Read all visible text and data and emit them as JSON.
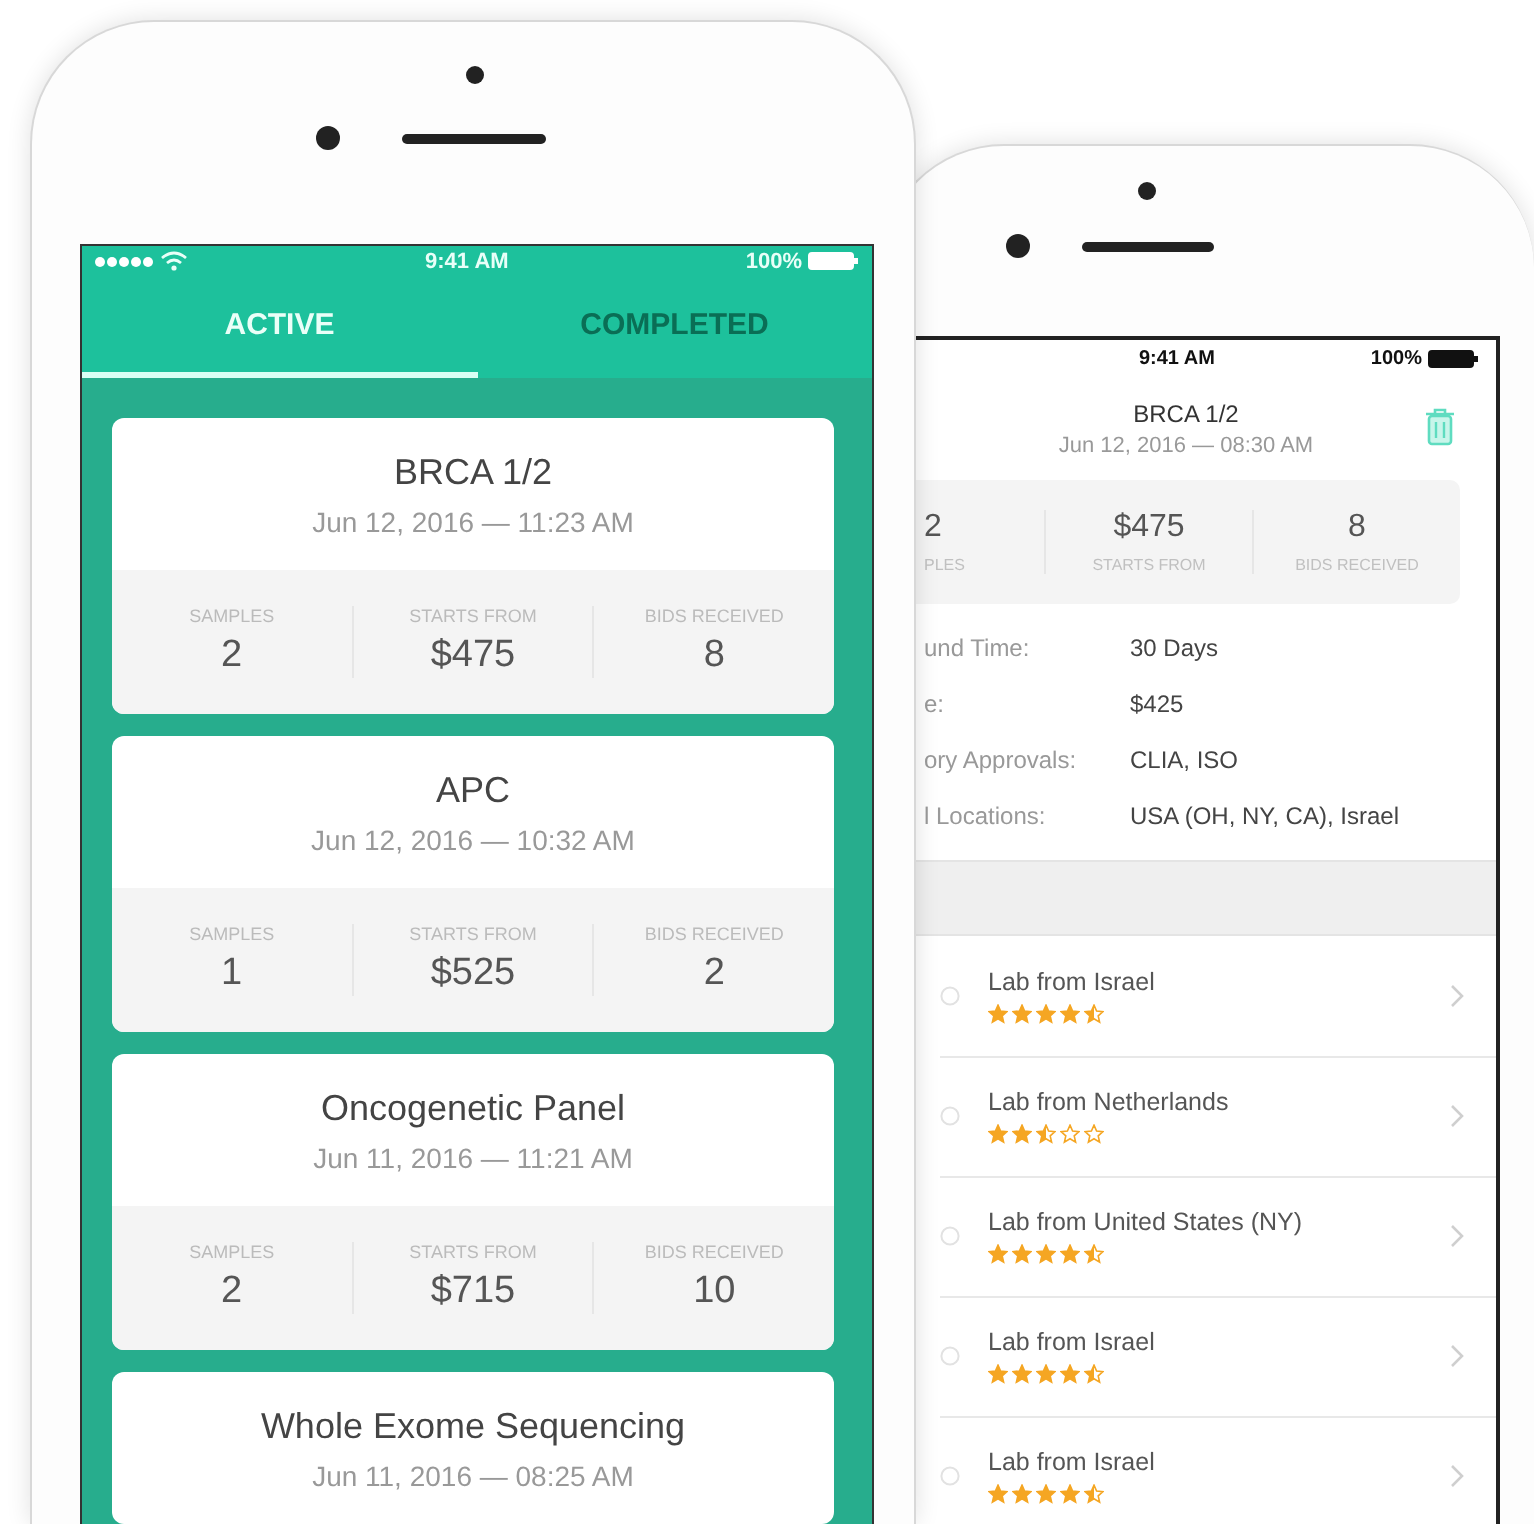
{
  "list_phone": {
    "status_bar": {
      "time": "9:41 AM",
      "battery": "100%"
    },
    "tabs": [
      {
        "label": "ACTIVE",
        "selected": true
      },
      {
        "label": "COMPLETED",
        "selected": false
      }
    ],
    "cards": [
      {
        "title": "BRCA 1/2",
        "date": "Jun 12, 2016 — 11:23 AM",
        "stats": [
          {
            "label": "SAMPLES",
            "value": "2"
          },
          {
            "label": "STARTS FROM",
            "value": "$475"
          },
          {
            "label": "BIDS RECEIVED",
            "value": "8"
          }
        ]
      },
      {
        "title": "APC",
        "date": "Jun 12, 2016 — 10:32 AM",
        "stats": [
          {
            "label": "SAMPLES",
            "value": "1"
          },
          {
            "label": "STARTS FROM",
            "value": "$525"
          },
          {
            "label": "BIDS RECEIVED",
            "value": "2"
          }
        ]
      },
      {
        "title": "Oncogenetic Panel",
        "date": "Jun 11, 2016 — 11:21 AM",
        "stats": [
          {
            "label": "SAMPLES",
            "value": "2"
          },
          {
            "label": "STARTS FROM",
            "value": "$715"
          },
          {
            "label": "BIDS RECEIVED",
            "value": "10"
          }
        ]
      },
      {
        "title": "Whole Exome Sequencing",
        "date": "Jun 11, 2016 — 08:25 AM"
      }
    ]
  },
  "detail_phone": {
    "status_bar": {
      "time": "9:41 AM",
      "battery": "100%"
    },
    "header": {
      "title": "BRCA 1/2",
      "date": "Jun 12, 2016 — 08:30 AM"
    },
    "stats": [
      {
        "label": "PLES",
        "value": "2"
      },
      {
        "label": "STARTS FROM",
        "value": "$475"
      },
      {
        "label": "BIDS RECEIVED",
        "value": "8"
      }
    ],
    "details": [
      {
        "label": "und Time:",
        "value": "30 Days"
      },
      {
        "label": "e:",
        "value": "$425"
      },
      {
        "label": "ory Approvals:",
        "value": "CLIA, ISO"
      },
      {
        "label": "l Locations:",
        "value": "USA (OH, NY, CA), Israel"
      }
    ],
    "labs": [
      {
        "name": "Lab from Israel",
        "stars": 4.5
      },
      {
        "name": "Lab from Netherlands",
        "stars": 2.5
      },
      {
        "name": "Lab from United States (NY)",
        "stars": 4.5
      },
      {
        "name": "Lab from Israel",
        "stars": 4.5
      },
      {
        "name": "Lab from Israel",
        "stars": 4.5
      }
    ]
  }
}
